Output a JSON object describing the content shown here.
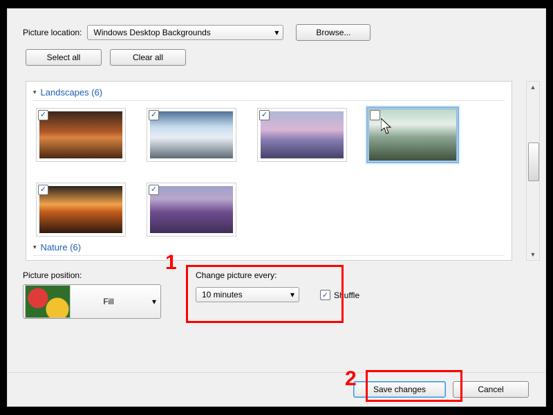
{
  "top": {
    "pictureLocationLabel": "Picture location:",
    "pictureLocationValue": "Windows Desktop Backgrounds",
    "browse": "Browse...",
    "selectAll": "Select all",
    "clearAll": "Clear all"
  },
  "gallery": {
    "groups": [
      {
        "title": "Landscapes (6)"
      },
      {
        "title": "Nature (6)"
      }
    ]
  },
  "position": {
    "label": "Picture position:",
    "value": "Fill"
  },
  "change": {
    "label": "Change picture every:",
    "value": "10 minutes",
    "shuffle": "Shuffle"
  },
  "buttons": {
    "save": "Save changes",
    "cancel": "Cancel"
  },
  "annotations": {
    "n1": "1",
    "n2": "2"
  }
}
